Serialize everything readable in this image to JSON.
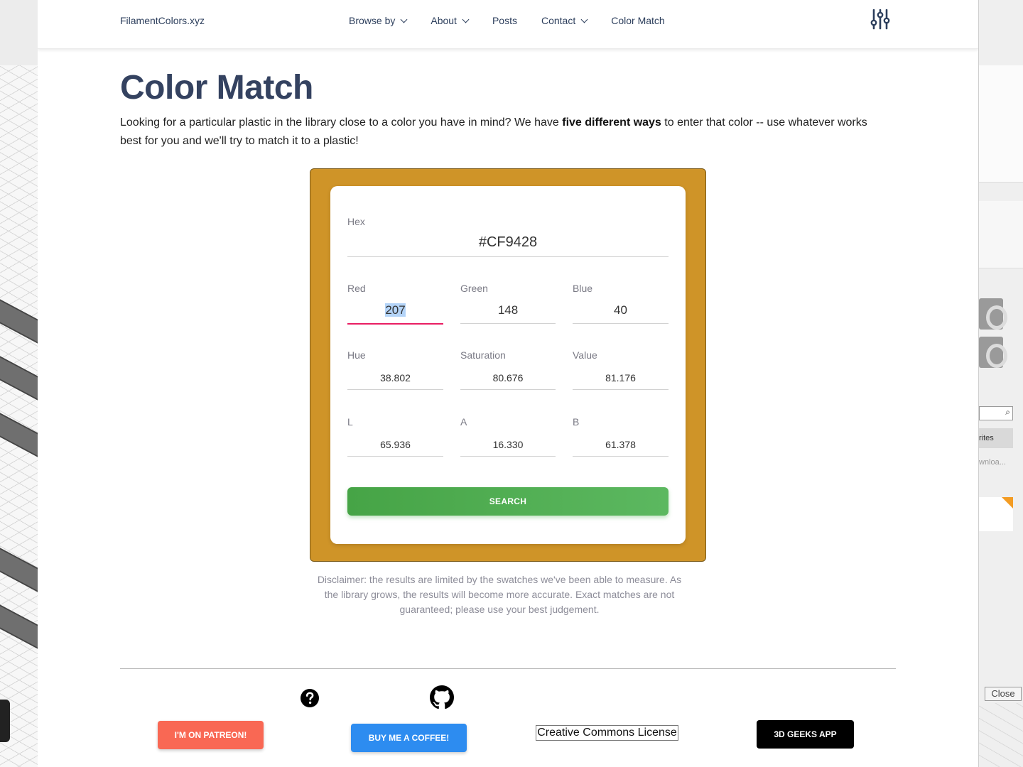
{
  "background_app": {
    "right_panel": {
      "favorites_tab": "rites",
      "downloads_text": "wnloa...",
      "close_button": "Close",
      "search_icon": "search-icon"
    }
  },
  "navbar": {
    "brand": "FilamentColors.xyz",
    "items": [
      {
        "label": "Browse by",
        "has_dropdown": true
      },
      {
        "label": "About",
        "has_dropdown": true
      },
      {
        "label": "Posts",
        "has_dropdown": false
      },
      {
        "label": "Contact",
        "has_dropdown": true
      },
      {
        "label": "Color Match",
        "has_dropdown": false
      }
    ],
    "settings_icon": "sliders-icon"
  },
  "main": {
    "title": "Color Match",
    "intro_before": "Looking for a particular plastic in the library close to a color you have in mind? We have ",
    "intro_bold": "five different ways",
    "intro_after": " to enter that color -- use whatever works best for you and we'll try to match it to a plastic!",
    "swatch_color": "#CF9428",
    "form": {
      "hex": {
        "label": "Hex",
        "value": "#CF9428"
      },
      "red": {
        "label": "Red",
        "value": "207"
      },
      "green": {
        "label": "Green",
        "value": "148"
      },
      "blue": {
        "label": "Blue",
        "value": "40"
      },
      "hue": {
        "label": "Hue",
        "value": "38.802"
      },
      "saturation": {
        "label": "Saturation",
        "value": "80.676"
      },
      "value": {
        "label": "Value",
        "value": "81.176"
      },
      "l": {
        "label": "L",
        "value": "65.936"
      },
      "a": {
        "label": "A",
        "value": "16.330"
      },
      "b": {
        "label": "B",
        "value": "61.378"
      },
      "search_label": "SEARCH"
    },
    "disclaimer": "Disclaimer: the results are limited by the swatches we've been able to measure. As the library grows, the results will become more accurate. Exact matches are not guaranteed; please use your best judgement."
  },
  "footer": {
    "help_icon": "question-circle-icon",
    "github_icon": "github-icon",
    "patreon_label": "I'M ON PATREON!",
    "coffee_label": "BUY ME A COFFEE!",
    "cc_label": "Creative Commons License",
    "geeks_label": "3D GEEKS APP"
  },
  "colors": {
    "title": "#344260",
    "nav_text": "#2c3e5c",
    "active_underline": "#e91e63",
    "search_button": "#4caf50",
    "patreon": "#f96854",
    "coffee": "#2d8cf0",
    "geeks": "#000000"
  }
}
